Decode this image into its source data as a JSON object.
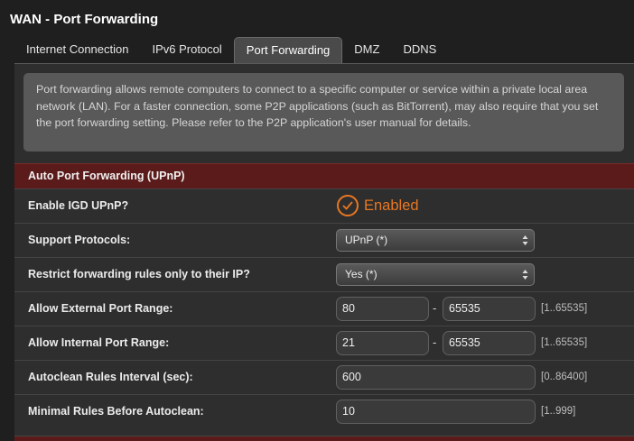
{
  "page_title": "WAN - Port Forwarding",
  "tabs": [
    {
      "label": "Internet Connection"
    },
    {
      "label": "IPv6 Protocol"
    },
    {
      "label": "Port Forwarding"
    },
    {
      "label": "DMZ"
    },
    {
      "label": "DDNS"
    }
  ],
  "active_tab": "Port Forwarding",
  "info_text": "Port forwarding allows remote computers to connect to a specific computer or service within a private local area network (LAN). For a faster connection, some P2P applications (such as BitTorrent), may also require that you set the port forwarding setting. Please refer to the P2P application's user manual for details.",
  "section": {
    "title": "Auto Port Forwarding (UPnP)",
    "enable_igd": {
      "label": "Enable IGD UPnP?",
      "status": "Enabled"
    },
    "protocols": {
      "label": "Support Protocols:",
      "value": "UPnP (*)"
    },
    "restrict": {
      "label": "Restrict forwarding rules only to their IP?",
      "value": "Yes (*)"
    },
    "ext_range": {
      "label": "Allow External Port Range:",
      "from": "80",
      "to": "65535",
      "hint": "[1..65535]"
    },
    "int_range": {
      "label": "Allow Internal Port Range:",
      "from": "21",
      "to": "65535",
      "hint": "[1..65535]"
    },
    "autoclean_interval": {
      "label": "Autoclean Rules Interval (sec):",
      "value": "600",
      "hint": "[0..86400]"
    },
    "min_rules": {
      "label": "Minimal Rules Before Autoclean:",
      "value": "10",
      "hint": "[1..999]"
    },
    "separator": "-"
  },
  "colors": {
    "accent": "#e87722",
    "section_header": "#5c1b1b",
    "background": "#1f1f1f"
  }
}
